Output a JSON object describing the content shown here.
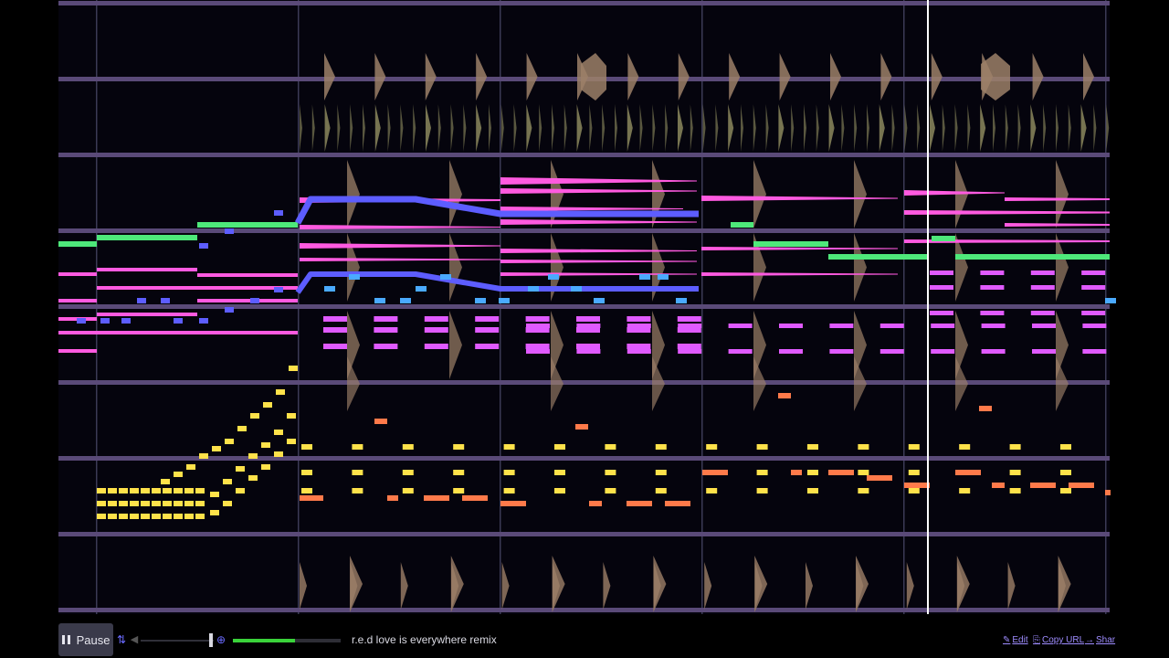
{
  "song": {
    "title": "r.e.d love is everywhere remix"
  },
  "controls": {
    "pause_label": "Pause",
    "loop_icon": "loop-icon",
    "volume_icon": "volume-icon",
    "zoom_icon": "zoom-icon",
    "volume_level": 0.95,
    "progress": 0.58
  },
  "links": {
    "edit_label": "Edit",
    "edit_icon": "pencil-icon",
    "copy_url_label": "Copy URL",
    "copy_icon": "copy-icon",
    "share_label": "Shar",
    "share_icon": "arrow-right-icon"
  },
  "colors": {
    "background": "#05040d",
    "channel_separator": "#5a4a78",
    "bar_line": "#3b3a55",
    "playhead": "#ffffff",
    "drum_channel": "#9c8068",
    "hat_channel": "#7d7a55",
    "pink_channel": "#ff5ae0",
    "magenta_channel": "#e05aff",
    "green_channel": "#4ee87a",
    "blue_channel": "#5d5dff",
    "cyan_channel": "#4aaaff",
    "yellow_channel": "#ffe24a",
    "orange_channel": "#ff7a4a",
    "progress_fill": "#3ad33a",
    "link": "#9e8cff"
  }
}
